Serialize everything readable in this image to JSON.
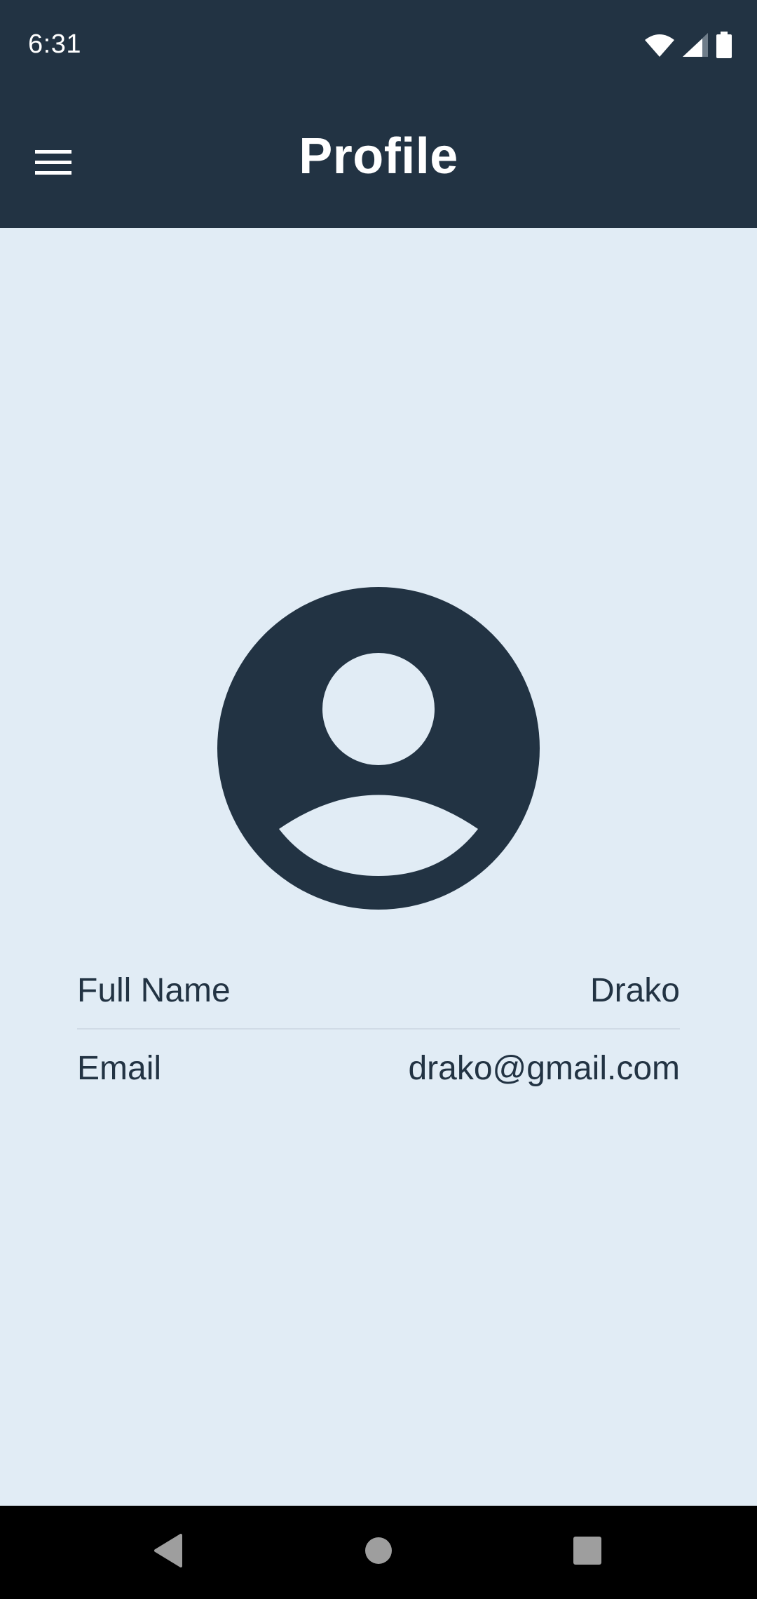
{
  "status_bar": {
    "time": "6:31",
    "icons": [
      "wifi-icon",
      "cellular-signal-icon",
      "battery-icon"
    ]
  },
  "app_bar": {
    "title": "Profile",
    "menu_icon": "hamburger-menu-icon"
  },
  "profile": {
    "avatar_icon": "account-circle-icon",
    "fields": [
      {
        "label": "Full Name",
        "value": "Drako"
      },
      {
        "label": "Email",
        "value": "drako@gmail.com"
      }
    ]
  },
  "nav_bar": {
    "buttons": [
      "back-icon",
      "home-icon",
      "recents-icon"
    ]
  },
  "colors": {
    "header_bg": "#223343",
    "content_bg": "#e1ecf5",
    "text": "#223343",
    "nav_bg": "#000000"
  }
}
